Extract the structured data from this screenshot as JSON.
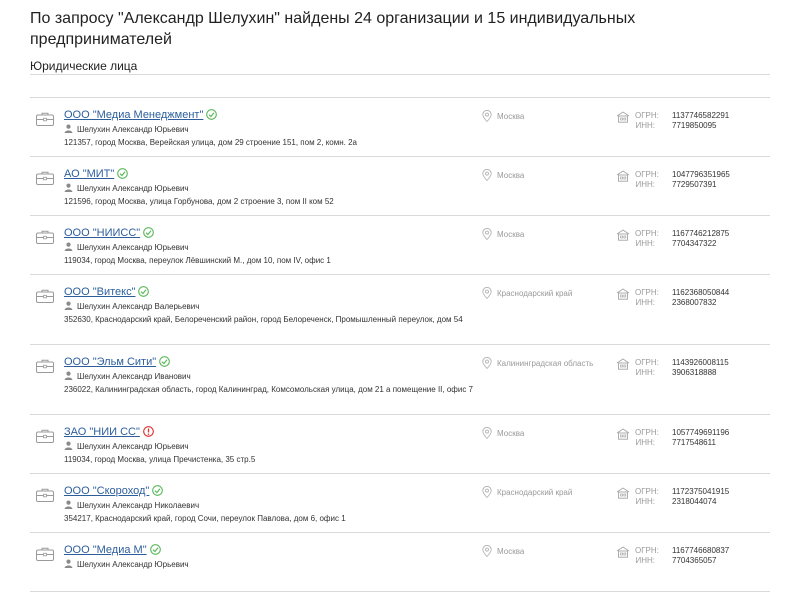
{
  "header": {
    "title": "По запросу \"Александр Шелухин\" найдены 24 организации и 15 индивидуальных предпринимателей",
    "section_label": "Юридические лица"
  },
  "labels": {
    "ogrn": "ОГРН:",
    "inn": "ИНН:"
  },
  "organizations": [
    {
      "name": "ООО \"Медиа Менеджмент\"",
      "status": "active",
      "person": "Шелухин Александр Юрьевич",
      "address": "121357, город Москва, Верейская улица, дом 29 строение 151, пом 2, комн. 2а",
      "region": "Москва",
      "ogrn": "1137746582291",
      "inn": "7719850095"
    },
    {
      "name": "АО \"МИТ\"",
      "status": "active",
      "person": "Шелухин Александр Юрьевич",
      "address": "121596, город Москва, улица Горбунова, дом 2 строение 3, пом II ком 52",
      "region": "Москва",
      "ogrn": "1047796351965",
      "inn": "7729507391"
    },
    {
      "name": "ООО \"НИИСС\"",
      "status": "active",
      "person": "Шелухин Александр Юрьевич",
      "address": "119034, город Москва, переулок Лёвшинский М., дом 10, пом IV, офис 1",
      "region": "Москва",
      "ogrn": "1167746212875",
      "inn": "7704347322"
    },
    {
      "name": "ООО \"Витекс\"",
      "status": "active",
      "person": "Шелухин Александр Валерьевич",
      "address": "352630, Краснодарский край, Белореченский район, город Белореченск, Промышленный переулок, дом 54",
      "region": "Краснодарский край",
      "ogrn": "1162368050844",
      "inn": "2368007832"
    },
    {
      "name": "ООО \"Эльм Сити\"",
      "status": "active",
      "person": "Шелухин Александр Иванович",
      "address": "236022, Калининградская область, город Калининград, Комсомольская улица, дом 21 а помещение II, офис 7",
      "region": "Калининградская область",
      "ogrn": "1143926008115",
      "inn": "3906318888"
    },
    {
      "name": "ЗАО \"НИИ СС\"",
      "status": "warning",
      "person": "Шелухин Александр Юрьевич",
      "address": "119034, город Москва, улица Пречистенка, 35 стр.5",
      "region": "Москва",
      "ogrn": "1057749691196",
      "inn": "7717548611"
    },
    {
      "name": "ООО \"Скороход\"",
      "status": "active",
      "person": "Шелухин Александр Николаевич",
      "address": "354217, Краснодарский край, город Сочи, переулок Павлова, дом 6, офис 1",
      "region": "Краснодарский край",
      "ogrn": "1172375041915",
      "inn": "2318044074"
    },
    {
      "name": "ООО \"Медиа М\"",
      "status": "active",
      "person": "Шелухин Александр Юрьевич",
      "address": "",
      "region": "Москва",
      "ogrn": "1167746680837",
      "inn": "7704365057"
    }
  ],
  "colors": {
    "link": "#2c5e9c",
    "active": "#5cb85c",
    "warning": "#e03030",
    "muted": "#9a9a9a",
    "divider": "#d9d9d9"
  },
  "icons": {
    "org": "briefcase-icon",
    "person": "person-icon",
    "region": "map-pin-icon",
    "registry": "building-icon",
    "active": "check-circle-icon",
    "warning": "exclamation-circle-icon"
  }
}
